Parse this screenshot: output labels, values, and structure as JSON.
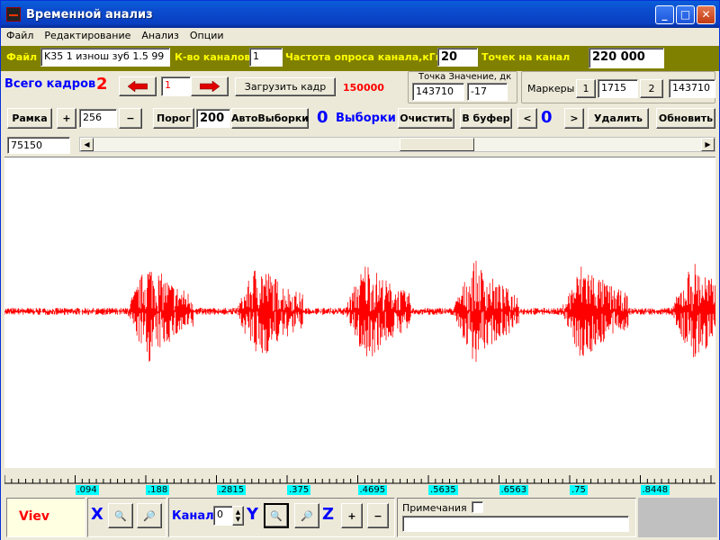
{
  "window": {
    "title": "Временной анализ"
  },
  "menu": [
    "Файл",
    "Редактирование",
    "Анализ",
    "Опции"
  ],
  "toolbar1": {
    "file_label": "Файл",
    "file_value": "K35  1 изнош зуб 1.5  99",
    "channels_label": "К-во каналов",
    "channels_value": "1",
    "rate_label": "Частота опроса канала,кГц",
    "rate_value": "20",
    "points_label": "Точек на канал",
    "points_value": "220 000"
  },
  "toolbar2": {
    "frames_label": "Всего кадров",
    "frames_value": "2",
    "frame_value": "1",
    "load_label": "Загрузить кадр",
    "load_count": "150000",
    "point_group": "Точка  Значение, дк",
    "point_value": "143710",
    "point_amp": "-17",
    "markers_label": "Маркеры",
    "m1_label": "1",
    "m1_value": "1715",
    "m2_label": "2",
    "m2_value": "143710"
  },
  "toolbar3": {
    "frame_btn": "Рамка",
    "plus": "+",
    "window_value": "256",
    "minus": "−",
    "threshold_label": "Порог",
    "threshold_value": "200",
    "auto_label": "АвтоВыборки",
    "samples_count": "0",
    "samples_label": "Выборки",
    "clear_label": "Очистить",
    "buffer_label": "В буфер",
    "prev": "<",
    "buffer_count": "0",
    "next": ">",
    "delete_label": "Удалить",
    "refresh_label": "Обновить"
  },
  "position": {
    "value": "75150"
  },
  "axis": {
    "ticks": [
      ".094",
      ".188",
      ".2815",
      ".375",
      ".4695",
      ".5635",
      ".6563",
      ".75",
      ".8448"
    ]
  },
  "bottom": {
    "view_label": "Viev",
    "x_label": "X",
    "channel_label": "Канал",
    "channel_value": "0",
    "y_label": "Y",
    "z_label": "Z",
    "plus": "+",
    "minus": "−",
    "notes_label": "Примечания",
    "notes_value": ""
  },
  "colors": {
    "signal": "#ff0000",
    "toolbar": "#808000",
    "label": "#ffff00"
  }
}
